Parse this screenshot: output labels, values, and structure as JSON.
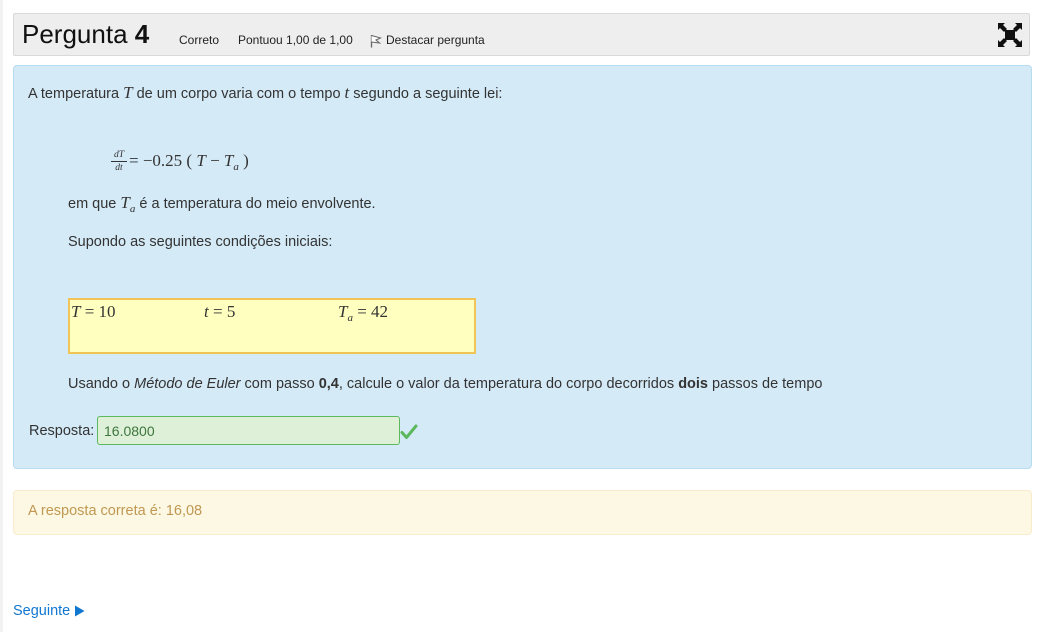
{
  "header": {
    "title_word": "Pergunta",
    "title_number": "4",
    "status": "Correto",
    "score": "Pontuou 1,00 de 1,00",
    "flag_label": "Destacar pergunta",
    "icons": {
      "flag": "flag-icon",
      "expand": "fullscreen-icon"
    }
  },
  "question": {
    "intro_a": "A temperatura ",
    "var_T": "T",
    "intro_b": " de um corpo varia com o tempo ",
    "var_t": "t",
    "intro_c": " segundo a seguinte lei:",
    "equation": {
      "frac_num": "dT",
      "frac_den": "dt",
      "rhs_a": " = −0.25 ( ",
      "rhs_T": "T",
      "rhs_minus": " − ",
      "rhs_Ta": "T",
      "rhs_sub": "a",
      "rhs_close": " )"
    },
    "env_a": "em que ",
    "env_var": "T",
    "env_sub": "a",
    "env_b": "  é a temperatura do meio envolvente.",
    "conditions_intro": "Supondo as seguintes condições iniciais:",
    "conditions": {
      "c1_var": "T",
      "c1_val": " = 10",
      "c2_var": "t",
      "c2_val": " = 5",
      "c3_var": "T",
      "c3_sub": "a",
      "c3_val": " = 42"
    },
    "task_a": "Usando o ",
    "task_method": "Método de Euler",
    "task_b": " com passo ",
    "task_step": "0,4",
    "task_c": ", calcule o valor da temperatura do corpo decorridos ",
    "task_steps": "dois",
    "task_d": " passos de tempo"
  },
  "answer": {
    "label": "Resposta:",
    "value": "16.0800",
    "status_icon": "check-icon",
    "status_color": "#5cb85c"
  },
  "feedback": {
    "text": "A resposta correta é: 16,08",
    "color": "#c09853",
    "background": "#fcf8e3"
  },
  "navigation": {
    "next_label": "Seguinte",
    "next_icon": "play-icon"
  },
  "colors": {
    "content_bg": "#d4eaf7",
    "header_bg": "#eeeeee",
    "highlight_box": "#ffffc0",
    "highlight_border": "#f1c458",
    "link": "#1177d1"
  }
}
